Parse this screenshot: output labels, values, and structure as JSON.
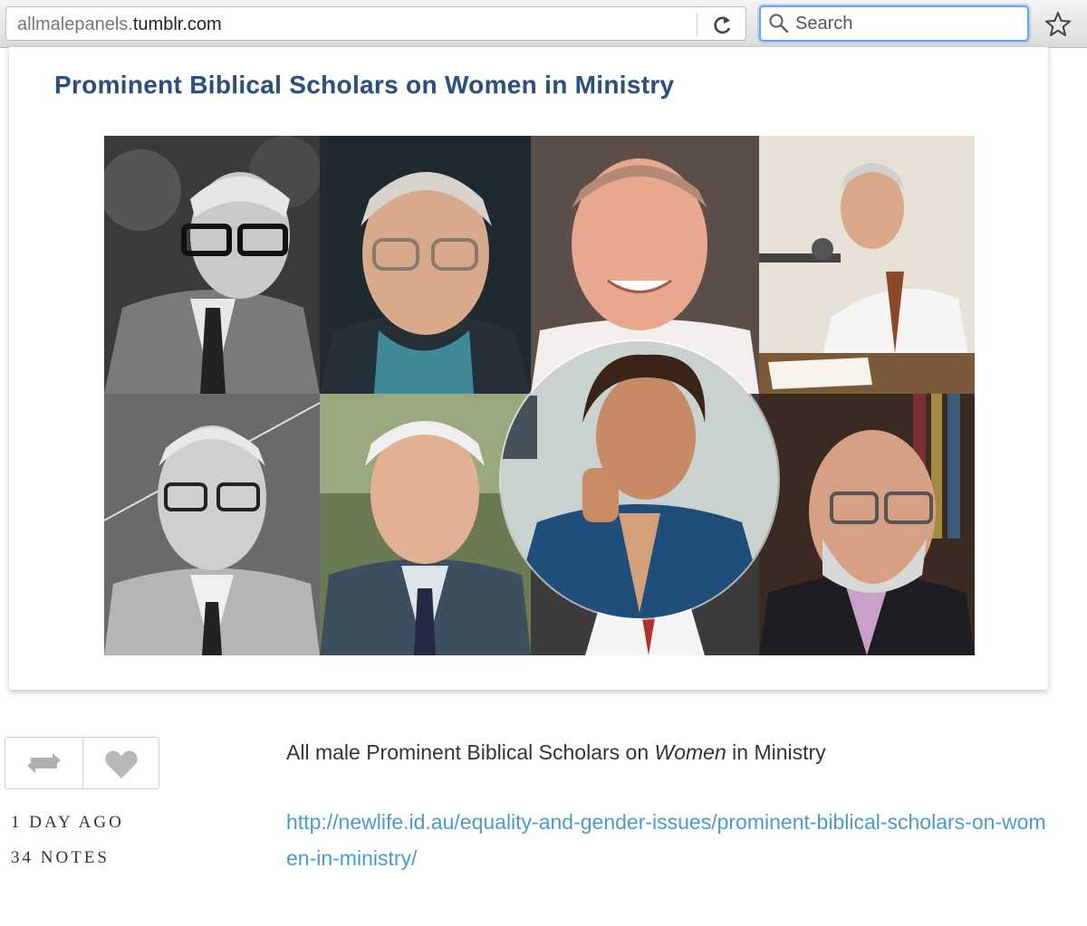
{
  "browser": {
    "url_prefix": "allmalepanels.",
    "url_host": "tumblr.com",
    "search_placeholder": "Search",
    "icons": {
      "reload": "reload-icon",
      "search": "search-icon",
      "bookmark": "star-icon"
    }
  },
  "post": {
    "image_title": "Prominent Biblical Scholars on Women in Ministry",
    "caption": {
      "before": "All male Prominent Biblical Scholars on ",
      "emphasis": "Women",
      "after": " in Ministry"
    },
    "link": "http://newlife.id.au/equality-and-gender-issues/prominent-biblical-scholars-on-women-in-ministry/",
    "time": "1 DAY AGO",
    "notes": "34 NOTES",
    "icons": {
      "reblog": "reblog-icon",
      "like": "heart-icon"
    },
    "colors": {
      "title": "#2c4f7e",
      "link": "#4a9bcc"
    }
  }
}
